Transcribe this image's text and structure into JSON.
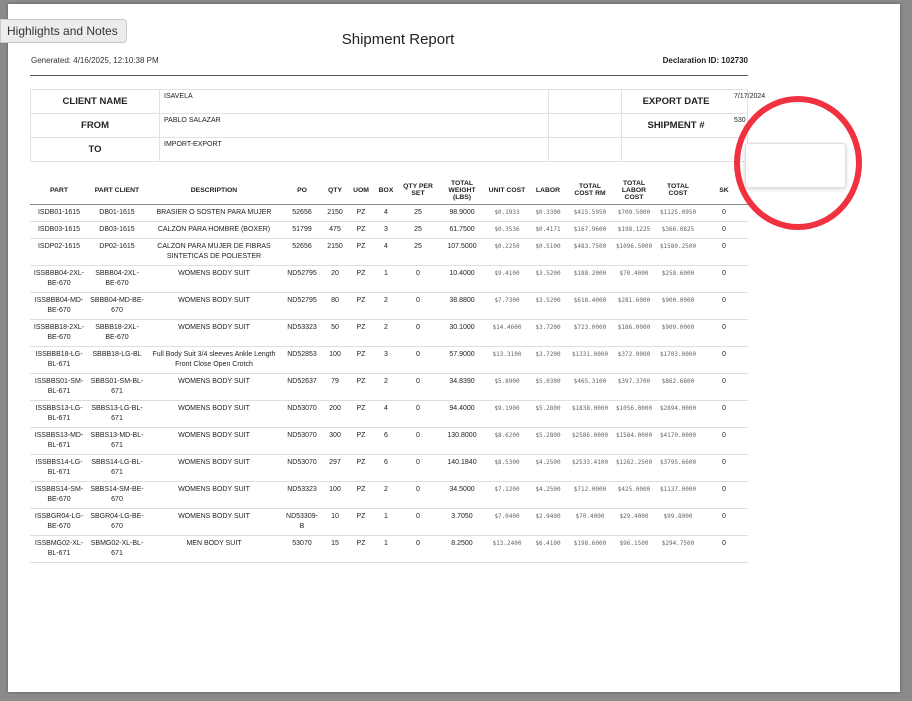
{
  "highlights_tab": "Highlights and Notes",
  "report": {
    "title": "Shipment Report",
    "generated": "Generated: 4/16/2025, 12:10:38 PM",
    "declaration": "Declaration ID: 102730"
  },
  "info": {
    "client_name_label": "CLIENT NAME",
    "client_name": "ISAVELA",
    "from_label": "FROM",
    "from": "PABLO SALAZAR",
    "to_label": "TO",
    "to": "IMPORT-EXPORT",
    "export_date_label": "EXPORT DATE",
    "export_date": "7/17/2024",
    "shipment_label": "SHIPMENT #",
    "shipment": "530"
  },
  "table": {
    "headers": [
      "PART",
      "PART CLIENT",
      "DESCRIPTION",
      "PO",
      "QTY",
      "UOM",
      "BOX",
      "QTY PER SET",
      "TOTAL WEIGHT (LBS)",
      "UNIT COST",
      "LABOR",
      "TOTAL COST RM",
      "TOTAL LABOR COST",
      "TOTAL COST",
      "SK"
    ],
    "rows": [
      [
        "ISDB01-1615",
        "DB01-1615",
        "BRASIER O SOSTEN PARA MUJER",
        "52656",
        "2150",
        "PZ",
        "4",
        "25",
        "98.9000",
        "$0.1933",
        "$0.3300",
        "$415.5950",
        "$709.5000",
        "$1125.0950",
        "0"
      ],
      [
        "ISDB03-1615",
        "DB03-1615",
        "CALZON PARA HOMBRE (BOXER)",
        "51799",
        "475",
        "PZ",
        "3",
        "25",
        "61.7500",
        "$0.3536",
        "$0.4171",
        "$167.9600",
        "$198.1225",
        "$366.0825",
        "0"
      ],
      [
        "ISDP02-1615",
        "DP02-1615",
        "CALZON PARA MUJER DE FIBRAS SINTETICAS DE POLIESTER",
        "52656",
        "2150",
        "PZ",
        "4",
        "25",
        "107.5000",
        "$0.2250",
        "$0.5100",
        "$483.7500",
        "$1096.5000",
        "$1580.2500",
        "0"
      ],
      [
        "ISSBBB04-2XL-BE-670",
        "SBBB04-2XL-BE-670",
        "WOMENS BODY SUIT",
        "ND52795",
        "20",
        "PZ",
        "1",
        "0",
        "10.4000",
        "$9.4100",
        "$3.5200",
        "$188.2000",
        "$70.4000",
        "$258.6000",
        "0"
      ],
      [
        "ISSBBB04-MD-BE-670",
        "SBBB04-MD-BE-670",
        "WOMENS BODY SUIT",
        "ND52795",
        "80",
        "PZ",
        "2",
        "0",
        "38.8800",
        "$7.7300",
        "$3.5200",
        "$618.4000",
        "$281.6000",
        "$900.0000",
        "0"
      ],
      [
        "ISSBBB18-2XL-BE-670",
        "SBBB18-2XL-BE-670",
        "WOMENS BODY SUIT",
        "ND53323",
        "50",
        "PZ",
        "2",
        "0",
        "30.1000",
        "$14.4600",
        "$3.7200",
        "$723.0000",
        "$186.0000",
        "$909.0000",
        "0"
      ],
      [
        "ISSBBB18-LG-BL-671",
        "SBBB18-LG-BL",
        "Full Body Suit 3/4 sleeves Ankle Length Front Close Open Crotch",
        "ND52853",
        "100",
        "PZ",
        "3",
        "0",
        "57.9000",
        "$13.3100",
        "$3.7200",
        "$1331.0000",
        "$372.0000",
        "$1703.0000",
        "0"
      ],
      [
        "ISSBBS01-SM-BL-671",
        "SBBS01-SM-BL-671",
        "WOMENS BODY SUIT",
        "ND52637",
        "79",
        "PZ",
        "2",
        "0",
        "34.8390",
        "$5.8900",
        "$5.0300",
        "$465.3100",
        "$397.3700",
        "$862.6800",
        "0"
      ],
      [
        "ISSBBS13-LG-BL-671",
        "SBBS13-LG-BL-671",
        "WOMENS BODY SUIT",
        "ND53070",
        "200",
        "PZ",
        "4",
        "0",
        "94.4000",
        "$9.1900",
        "$5.2800",
        "$1838.0000",
        "$1056.0000",
        "$2894.0000",
        "0"
      ],
      [
        "ISSBBS13-MD-BL-671",
        "SBBS13-MD-BL-671",
        "WOMENS BODY SUIT",
        "ND53070",
        "300",
        "PZ",
        "6",
        "0",
        "130.8000",
        "$8.6200",
        "$5.2800",
        "$2586.0000",
        "$1584.0000",
        "$4170.0000",
        "0"
      ],
      [
        "ISSBBS14-LG-BL-671",
        "SBBS14-LG-BL-671",
        "WOMENS BODY SUIT",
        "ND53070",
        "297",
        "PZ",
        "6",
        "0",
        "140.1840",
        "$8.5300",
        "$4.2500",
        "$2533.4100",
        "$1262.2500",
        "$3795.6600",
        "0"
      ],
      [
        "ISSBBS14-SM-BE-670",
        "SBBS14-SM-BE-670",
        "WOMENS BODY SUIT",
        "ND53323",
        "100",
        "PZ",
        "2",
        "0",
        "34.5000",
        "$7.1200",
        "$4.2500",
        "$712.0000",
        "$425.0000",
        "$1137.0000",
        "0"
      ],
      [
        "ISSBGR04-LG-BE-670",
        "SBGR04-LG-BE-670",
        "WOMENS BODY SUIT",
        "ND53309-B",
        "10",
        "PZ",
        "1",
        "0",
        "3.7050",
        "$7.0400",
        "$2.9400",
        "$70.4000",
        "$29.4000",
        "$99.8000",
        "0"
      ],
      [
        "ISSBMG02-XL-BL-671",
        "SBMG02-XL-BL-671",
        "MEN BODY SUIT",
        "53070",
        "15",
        "PZ",
        "1",
        "0",
        "8.2500",
        "$13.2400",
        "$6.4100",
        "$198.6000",
        "$96.1500",
        "$294.7500",
        "0"
      ]
    ]
  },
  "colors": {
    "annotation_ring": "#f0313f",
    "page_background": "#ffffff",
    "viewer_background": "#8a8a8a"
  }
}
